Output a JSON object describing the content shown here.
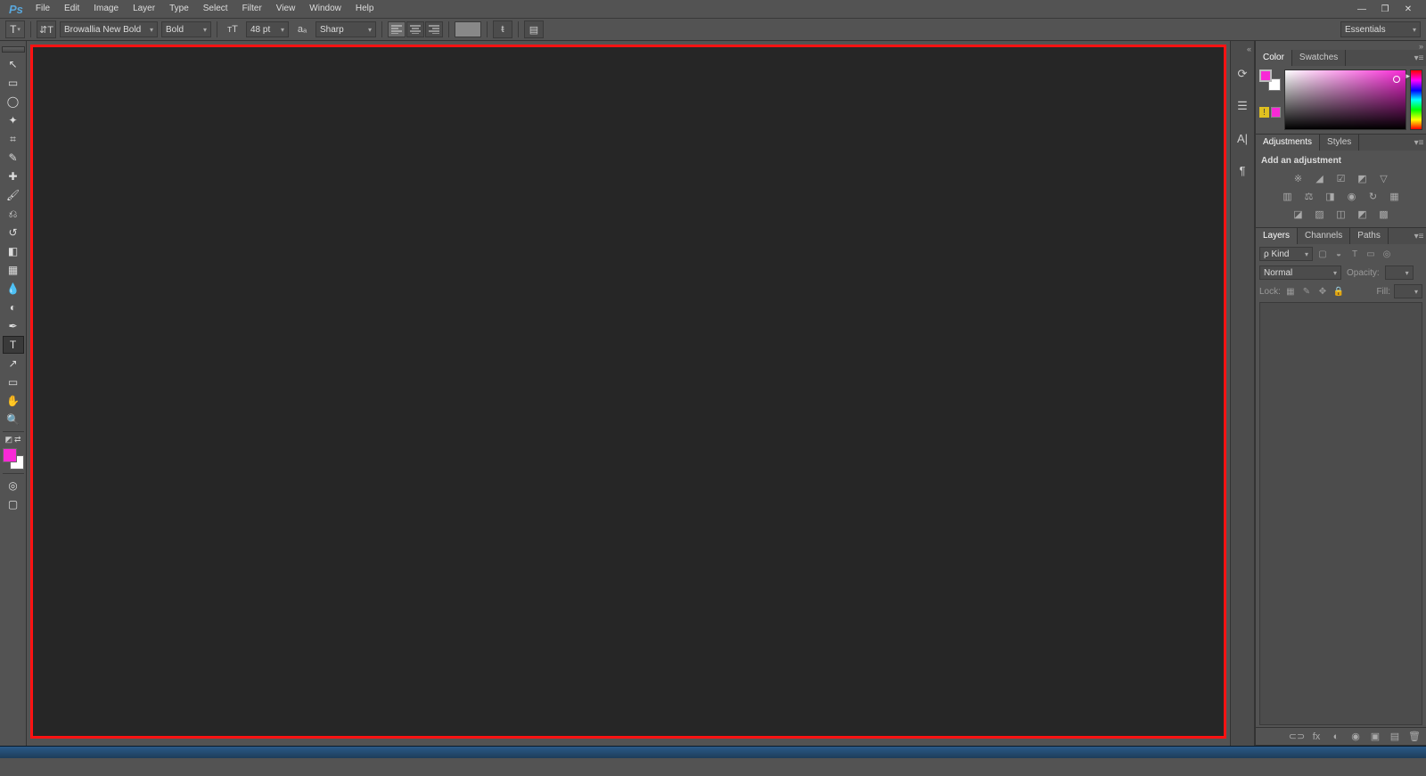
{
  "app": {
    "name": "Ps"
  },
  "menu": {
    "items": [
      "File",
      "Edit",
      "Image",
      "Layer",
      "Type",
      "Select",
      "Filter",
      "View",
      "Window",
      "Help"
    ]
  },
  "window_controls": {
    "minimize": "—",
    "maximize": "❐",
    "close": "✕"
  },
  "options": {
    "tool_glyph": "T",
    "orientation_glyph": "⇵T",
    "font_family": "Browallia New Bold",
    "font_style": "Bold",
    "font_size": "48 pt",
    "aa_prefix": "aₐ",
    "antialias": "Sharp",
    "align": {
      "left": "≡",
      "center": "≡",
      "right": "≡"
    },
    "warp_glyph": "ᵵ",
    "panel_glyph": "▤"
  },
  "workspace": {
    "selected": "Essentials"
  },
  "tools": {
    "items": [
      {
        "name": "move-tool",
        "glyph": "↖"
      },
      {
        "name": "marquee-tool",
        "glyph": "▭"
      },
      {
        "name": "lasso-tool",
        "glyph": "◯"
      },
      {
        "name": "wand-tool",
        "glyph": "✦"
      },
      {
        "name": "crop-tool",
        "glyph": "⌗"
      },
      {
        "name": "eyedropper-tool",
        "glyph": "✎"
      },
      {
        "name": "healing-tool",
        "glyph": "✚"
      },
      {
        "name": "brush-tool",
        "glyph": "🖌"
      },
      {
        "name": "stamp-tool",
        "glyph": "⎌"
      },
      {
        "name": "history-brush-tool",
        "glyph": "↺"
      },
      {
        "name": "eraser-tool",
        "glyph": "◧"
      },
      {
        "name": "gradient-tool",
        "glyph": "▦"
      },
      {
        "name": "blur-tool",
        "glyph": "💧"
      },
      {
        "name": "dodge-tool",
        "glyph": "◐"
      },
      {
        "name": "pen-tool",
        "glyph": "✒"
      },
      {
        "name": "type-tool",
        "glyph": "T",
        "active": true
      },
      {
        "name": "path-tool",
        "glyph": "↗"
      },
      {
        "name": "shape-tool",
        "glyph": "▭"
      },
      {
        "name": "hand-tool",
        "glyph": "✋"
      },
      {
        "name": "zoom-tool",
        "glyph": "🔍"
      }
    ],
    "swap_glyph": "⇄",
    "default_glyph": "◩",
    "quickmask_glyph": "◎",
    "screenmode_glyph": "▢"
  },
  "mini_panels": {
    "items": [
      {
        "name": "history-icon",
        "glyph": "⟳"
      },
      {
        "name": "properties-icon",
        "glyph": "☰"
      },
      {
        "name": "character-icon",
        "glyph": "A|"
      },
      {
        "name": "paragraph-icon",
        "glyph": "¶"
      }
    ]
  },
  "panels": {
    "color": {
      "tabs": [
        "Color",
        "Swatches"
      ],
      "foreground": "#f829d6",
      "background": "#ffffff"
    },
    "adjustments": {
      "tabs": [
        "Adjustments",
        "Styles"
      ],
      "heading": "Add an adjustment",
      "rows": [
        [
          "※",
          "◢",
          "☑",
          "◩",
          "▽"
        ],
        [
          "▥",
          "⚖",
          "◨",
          "◉",
          "↻",
          "▦"
        ],
        [
          "◪",
          "▨",
          "◫",
          "◩",
          "▩"
        ]
      ]
    },
    "layers": {
      "tabs": [
        "Layers",
        "Channels",
        "Paths"
      ],
      "kind_label": "ρ Kind",
      "filter_icons": [
        "▢",
        "◒",
        "T",
        "▭",
        "◎"
      ],
      "blend_mode": "Normal",
      "opacity_label": "Opacity:",
      "opacity_value": "",
      "lock_label": "Lock:",
      "lock_icons": [
        "▦",
        "✎",
        "✥",
        "🔒"
      ],
      "fill_label": "Fill:",
      "fill_value": "",
      "footer_icons": [
        "⊂⊃",
        "fx",
        "◐",
        "◉",
        "▣",
        "▤",
        "🗑"
      ]
    }
  }
}
